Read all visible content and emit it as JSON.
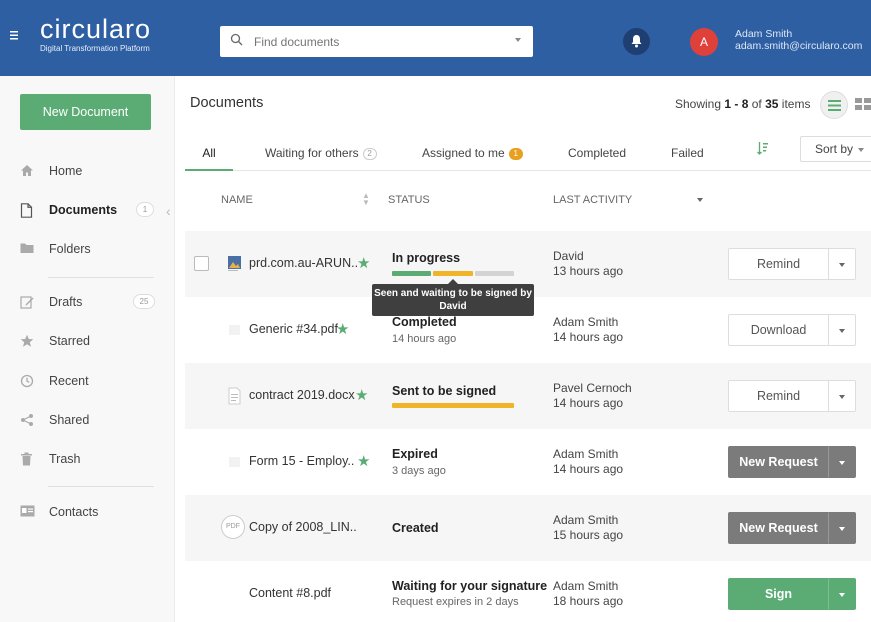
{
  "header": {
    "logo_name": "circularo",
    "logo_tagline": "Digital Transformation Platform",
    "search_placeholder": "Find documents",
    "avatar_initial": "A",
    "user_name": "Adam Smith",
    "user_email": "adam.smith@circularo.com",
    "brand_color": "#2f5fa3"
  },
  "sidebar": {
    "new_document_label": "New Document",
    "items": [
      {
        "label": "Home",
        "icon": "home-icon"
      },
      {
        "label": "Documents",
        "icon": "document-icon",
        "count": "1",
        "active": true
      },
      {
        "label": "Folders",
        "icon": "folder-icon"
      },
      {
        "label": "Drafts",
        "icon": "pencil-icon",
        "count": "25"
      },
      {
        "label": "Starred",
        "icon": "star-icon"
      },
      {
        "label": "Recent",
        "icon": "clock-icon"
      },
      {
        "label": "Shared",
        "icon": "share-icon"
      },
      {
        "label": "Trash",
        "icon": "trash-icon"
      },
      {
        "label": "Contacts",
        "icon": "contact-card-icon"
      }
    ]
  },
  "main": {
    "title": "Documents",
    "showing_prefix": "Showing",
    "showing_range": "1 - 8",
    "showing_of": "of",
    "showing_total": "35",
    "showing_suffix": "items",
    "tabs": [
      {
        "label": "All",
        "active": true
      },
      {
        "label": "Waiting for others",
        "badge": "2"
      },
      {
        "label": "Assigned to me",
        "badge": "1"
      },
      {
        "label": "Completed"
      },
      {
        "label": "Failed"
      }
    ],
    "sort_label": "Sort by",
    "columns": {
      "name": "NAME",
      "status": "STATUS",
      "activity": "LAST ACTIVITY"
    },
    "rows": [
      {
        "name": "prd.com.au-ARUN..",
        "starred": true,
        "status": "In progress",
        "progress": [
          1,
          1,
          0
        ],
        "activity_user": "David",
        "activity_time": "13 hours ago",
        "action": "Remind",
        "action_style": "outline"
      },
      {
        "name": "Generic #34.pdf",
        "starred": true,
        "status": "Completed",
        "status_sub": "14 hours ago",
        "activity_user": "Adam Smith",
        "activity_time": "14 hours ago",
        "action": "Download",
        "action_style": "outline"
      },
      {
        "name": "contract 2019.docx",
        "starred": true,
        "status": "Sent to be signed",
        "progress": [
          1
        ],
        "activity_user": "Pavel Cernoch",
        "activity_time": "14 hours ago",
        "action": "Remind",
        "action_style": "outline"
      },
      {
        "name": "Form 15 - Employ..",
        "starred": true,
        "status": "Expired",
        "status_sub": "3 days ago",
        "activity_user": "Adam Smith",
        "activity_time": "14 hours ago",
        "action": "New Request",
        "action_style": "grey"
      },
      {
        "name": "Copy of 2008_LIN..",
        "starred": false,
        "status": "Created",
        "activity_user": "Adam Smith",
        "activity_time": "15 hours ago",
        "action": "New Request",
        "action_style": "grey"
      },
      {
        "name": "Content #8.pdf",
        "starred": false,
        "status": "Waiting for your signature",
        "status_sub": "Request expires in 2 days",
        "activity_user": "Adam Smith",
        "activity_time": "18 hours ago",
        "action": "Sign",
        "action_style": "green"
      }
    ],
    "tooltip_text": "Seen and waiting to be signed by David",
    "colors": {
      "green": "#5aab74",
      "yellow": "#f0b429",
      "grey_bar": "#d3d3d3",
      "grey_button": "#7b7b7b"
    }
  }
}
